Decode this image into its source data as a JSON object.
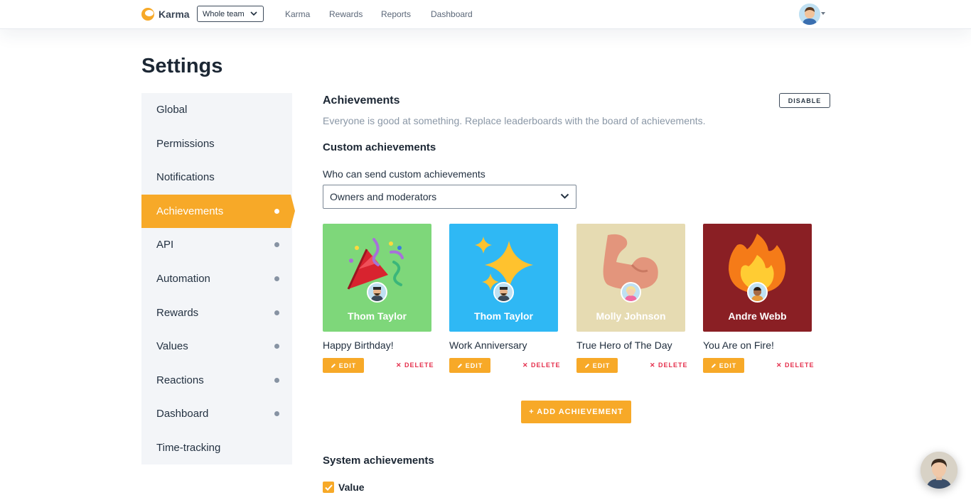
{
  "header": {
    "brand": "Karma",
    "team_select": "Whole team",
    "nav": [
      "Karma",
      "Rewards",
      "Reports",
      "Dashboard"
    ]
  },
  "page": {
    "title": "Settings"
  },
  "sidebar": {
    "items": [
      {
        "label": "Global",
        "dot": false,
        "active": false
      },
      {
        "label": "Permissions",
        "dot": false,
        "active": false
      },
      {
        "label": "Notifications",
        "dot": false,
        "active": false
      },
      {
        "label": "Achievements",
        "dot": true,
        "active": true
      },
      {
        "label": "API",
        "dot": true,
        "active": false
      },
      {
        "label": "Automation",
        "dot": true,
        "active": false
      },
      {
        "label": "Rewards",
        "dot": true,
        "active": false
      },
      {
        "label": "Values",
        "dot": true,
        "active": false
      },
      {
        "label": "Reactions",
        "dot": true,
        "active": false
      },
      {
        "label": "Dashboard",
        "dot": true,
        "active": false
      },
      {
        "label": "Time-tracking",
        "dot": false,
        "active": false
      }
    ]
  },
  "achievements": {
    "heading": "Achievements",
    "disable_button": "DISABLE",
    "description": "Everyone is good at something. Replace leaderboards with the board of achievements.",
    "custom_heading": "Custom achievements",
    "who_label": "Who can send custom achievements",
    "who_value": "Owners and moderators",
    "cards": [
      {
        "person": "Thom Taylor",
        "title": "Happy Birthday!",
        "bg": "#7ed77a",
        "icon": "party-popper-icon"
      },
      {
        "person": "Thom Taylor",
        "title": "Work Anniversary",
        "bg": "#2fb8f4",
        "icon": "sparkles-icon"
      },
      {
        "person": "Molly Johnson",
        "title": "True Hero of The Day",
        "bg": "#e6dbb2",
        "icon": "flexed-biceps-icon"
      },
      {
        "person": "Andre Webb",
        "title": "You Are on Fire!",
        "bg": "#8a1f24",
        "icon": "fire-icon"
      }
    ],
    "edit_label": "EDIT",
    "delete_label": "DELETE",
    "add_button": "+ ADD ACHIEVEMENT",
    "system_heading": "System achievements",
    "system_items": [
      {
        "label": "Value",
        "checked": true
      }
    ]
  },
  "colors": {
    "accent": "#f7a928",
    "danger": "#e5304d",
    "sidebar_bg": "#f3f5f8",
    "muted_text": "#8a97a6"
  }
}
